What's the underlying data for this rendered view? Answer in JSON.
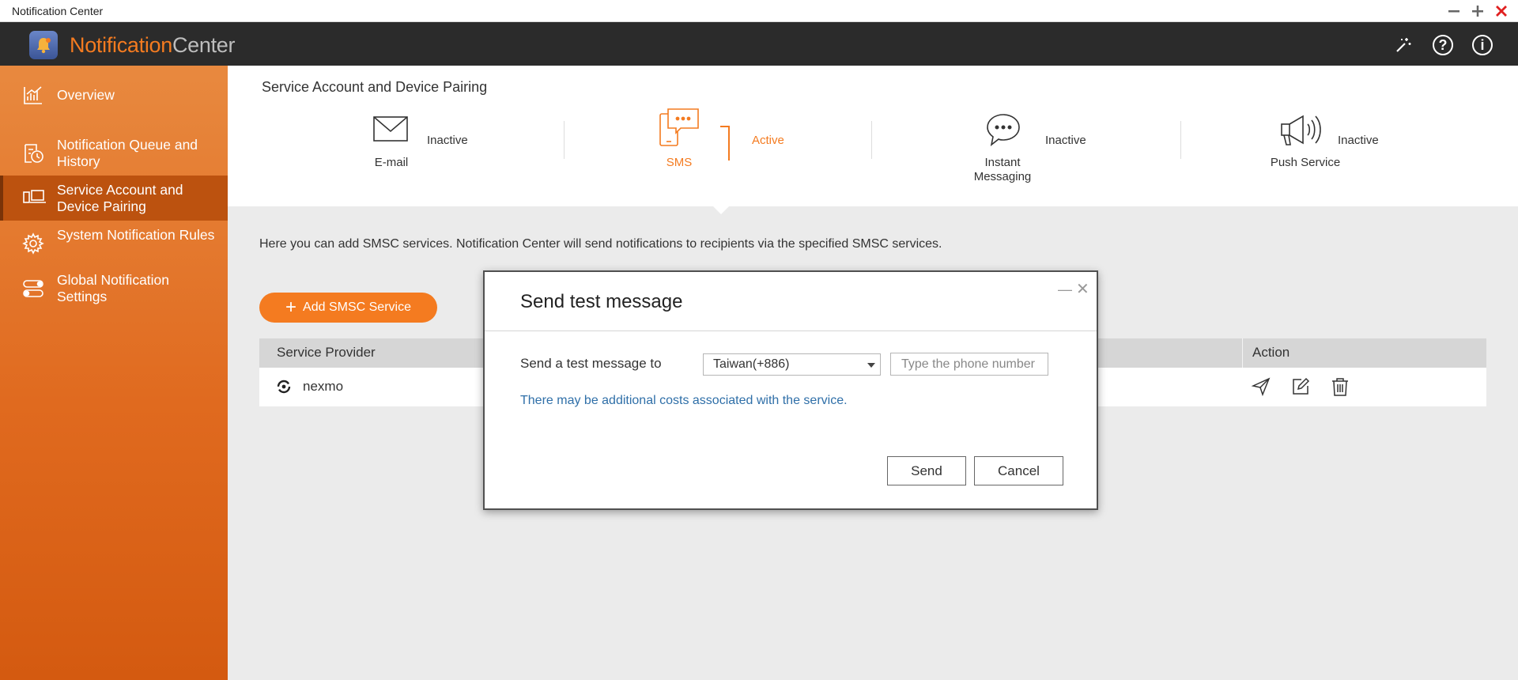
{
  "window": {
    "title": "Notification Center",
    "controls": [
      "minimize-icon",
      "maximize-icon",
      "close-icon"
    ]
  },
  "app": {
    "name_main": "Notification",
    "name_light": "Center",
    "header_icons": [
      "magic-wand-icon",
      "help-icon",
      "info-icon"
    ]
  },
  "sidebar": {
    "items": [
      {
        "label": "Overview",
        "icon": "chart-icon",
        "active": false
      },
      {
        "label": "Notification Queue and History",
        "icon": "history-icon",
        "active": false
      },
      {
        "label": "Service Account and Device Pairing",
        "icon": "device-pairing-icon",
        "active": true
      },
      {
        "label": "System Notification Rules",
        "icon": "gear-icon",
        "active": false
      },
      {
        "label": "Global Notification Settings",
        "icon": "toggle-icon",
        "active": false
      }
    ]
  },
  "main": {
    "title": "Service Account and Device Pairing",
    "services": [
      {
        "label": "E-mail",
        "status": "Inactive",
        "icon": "envelope-icon"
      },
      {
        "label": "SMS",
        "status": "Active",
        "icon": "sms-phone-icon"
      },
      {
        "label": "Instant Messaging",
        "status": "Inactive",
        "icon": "chat-bubble-icon"
      },
      {
        "label": "Push Service",
        "status": "Inactive",
        "icon": "megaphone-icon"
      }
    ],
    "description": "Here you can add SMSC services. Notification Center will send notifications to recipients via the specified SMSC services.",
    "add_button": "Add SMSC Service",
    "table": {
      "columns": [
        "Service Provider",
        "Action"
      ],
      "rows": [
        {
          "provider": "nexmo",
          "actions": [
            "send-icon",
            "edit-icon",
            "trash-icon"
          ]
        }
      ]
    }
  },
  "dialog": {
    "title": "Send test message",
    "label": "Send a test message to",
    "country_value": "Taiwan(+886)",
    "phone_placeholder": "Type the phone number",
    "note": "There may be additional costs associated with the service.",
    "send_label": "Send",
    "cancel_label": "Cancel"
  },
  "colors": {
    "accent": "#f47b20",
    "header_bg": "#2b2b2b",
    "sidebar_active": "#bc520f",
    "note_text": "#2f6fa8"
  }
}
